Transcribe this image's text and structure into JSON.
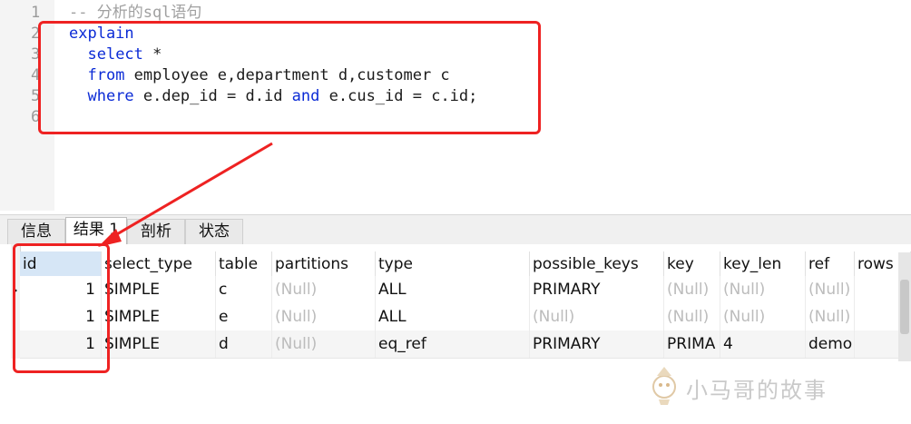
{
  "editor": {
    "line_numbers": [
      "1",
      "2",
      "3",
      "4",
      "5",
      "6"
    ],
    "lines": [
      [
        {
          "t": "-- 分析的sql语句",
          "c": "cm"
        }
      ],
      [
        {
          "t": "explain",
          "c": "kw"
        }
      ],
      [
        {
          "t": "  ",
          "c": ""
        },
        {
          "t": "select",
          "c": "kw"
        },
        {
          "t": " *",
          "c": ""
        }
      ],
      [
        {
          "t": "  ",
          "c": ""
        },
        {
          "t": "from",
          "c": "kw"
        },
        {
          "t": " employee e,department d,customer c",
          "c": ""
        }
      ],
      [
        {
          "t": "  ",
          "c": ""
        },
        {
          "t": "where",
          "c": "kw"
        },
        {
          "t": " e.dep_id = d.id ",
          "c": ""
        },
        {
          "t": "and",
          "c": "kw"
        },
        {
          "t": " e.cus_id = c.id;",
          "c": ""
        }
      ],
      []
    ]
  },
  "tabs": [
    {
      "label": "信息",
      "active": false
    },
    {
      "label": "结果 1",
      "active": true
    },
    {
      "label": "剖析",
      "active": false
    },
    {
      "label": "状态",
      "active": false
    }
  ],
  "grid": {
    "columns": [
      "id",
      "select_type",
      "table",
      "partitions",
      "type",
      "possible_keys",
      "key",
      "key_len",
      "ref",
      "rows"
    ],
    "rows": [
      [
        "1",
        "SIMPLE",
        "c",
        "(Null)",
        "ALL",
        "PRIMARY",
        "(Null)",
        "(Null)",
        "(Null)",
        ""
      ],
      [
        "1",
        "SIMPLE",
        "e",
        "(Null)",
        "ALL",
        "(Null)",
        "(Null)",
        "(Null)",
        "(Null)",
        ""
      ],
      [
        "1",
        "SIMPLE",
        "d",
        "(Null)",
        "eq_ref",
        "PRIMARY",
        "PRIMA",
        "4",
        "demo",
        ""
      ]
    ]
  },
  "watermark": {
    "text": "小马哥的故事"
  },
  "colors": {
    "keyword": "#0b2bd6",
    "annotation": "#ee2222",
    "null_text": "#bcbcbc",
    "selected_header": "#d6e6f6"
  }
}
